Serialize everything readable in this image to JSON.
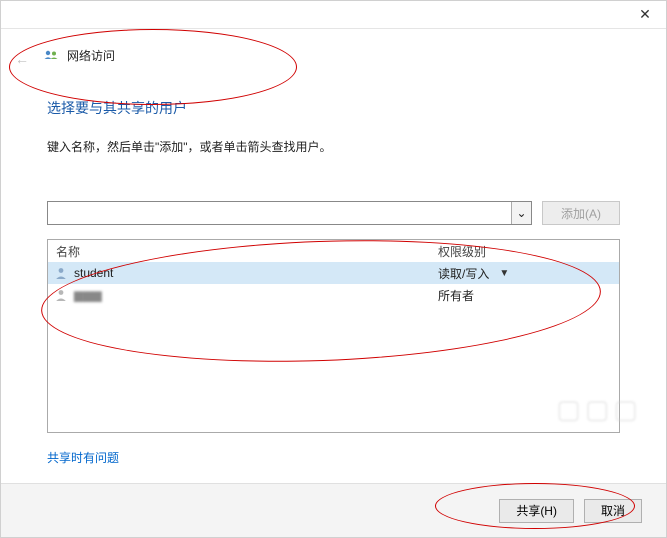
{
  "titlebar": {
    "close": "✕"
  },
  "header": {
    "back_glyph": "←",
    "title": "网络访问"
  },
  "heading": "选择要与其共享的用户",
  "instruction": "键入名称，然后单击\"添加\"，或者单击箭头查找用户。",
  "combo": {
    "value": "",
    "drop_glyph": "⌄"
  },
  "add_button": "添加(A)",
  "table": {
    "columns": {
      "name": "名称",
      "permission": "权限级别"
    },
    "rows": [
      {
        "user": "student",
        "permission": "读取/写入",
        "blurred": false,
        "has_dropdown": true,
        "selected": true
      },
      {
        "user": "▆▆▆",
        "permission": "所有者",
        "blurred": true,
        "has_dropdown": false,
        "selected": false
      }
    ],
    "perm_drop_glyph": "▼"
  },
  "help_link": "共享时有问题",
  "footer": {
    "share": "共享(H)",
    "cancel": "取消"
  },
  "colors": {
    "heading": "#1a5aa8",
    "link": "#0066cc",
    "selected_row": "#d4e8f7",
    "annotation": "#d00000"
  }
}
